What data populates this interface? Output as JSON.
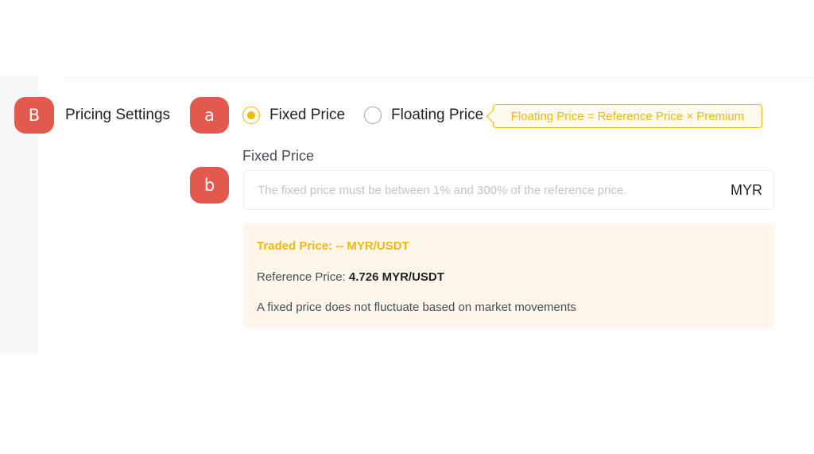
{
  "markers": {
    "section": "B",
    "pricing_type": "a",
    "fixed_price": "b"
  },
  "section": {
    "title": "Pricing Settings"
  },
  "price_type": {
    "options": [
      {
        "label": "Fixed Price",
        "selected": true
      },
      {
        "label": "Floating Price",
        "selected": false
      }
    ],
    "tooltip": "Floating Price = Reference Price × Premium"
  },
  "fixed_price": {
    "label": "Fixed Price",
    "value": "",
    "placeholder": "The fixed price must be between 1% and 300% of the reference price.",
    "unit": "MYR"
  },
  "info": {
    "traded_price": "Traded Price: -- MYR/USDT",
    "reference_label": "Reference Price: ",
    "reference_value": "4.726 MYR/USDT",
    "note": "A fixed price does not fluctuate based on market movements"
  },
  "colors": {
    "accent": "#f0b90b",
    "marker": "#e25a4e",
    "info_bg": "#fef6ea",
    "text": "#1e2329"
  }
}
